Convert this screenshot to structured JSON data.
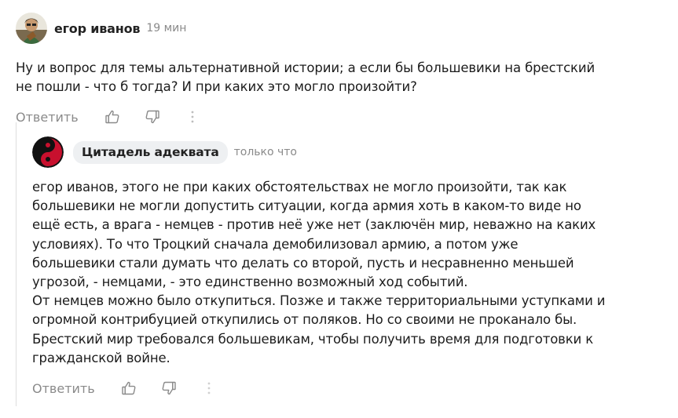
{
  "comments": [
    {
      "author": "егор иванов",
      "time": "19 мин",
      "text": "Ну и вопрос для темы альтернативной истории; а если бы большевики на брестский\nне пошли - что б тогда? И при каких это могло произойти?",
      "reply_label": "Ответить",
      "icons": [
        "thumbs-up-icon",
        "thumbs-down-icon",
        "more-vertical-icon"
      ]
    },
    {
      "author": "Цитадель адеквата",
      "time": "только что",
      "text": "егор иванов, этого не при каких обстоятельствах не могло произойти, так как\nбольшевики не могли допустить ситуации, когда армия хоть в каком-то виде но\nещё есть, а врага - немцев - против неё уже нет (заключён мир, неважно на каких\nусловиях). То что Троцкий сначала демобилизовал армию, а потом уже\nбольшевики стали думать что делать со второй, пусть и несравненно меньшей\nугрозой, - немцами, - это единственно возможный ход событий.\nОт немцев можно было откупиться. Позже и также территориальными уступками и\nогромной контрибуцией откупились от поляков. Но со своими не проканало бы.\nБрестский мир требовался большевикам, чтобы получить время для подготовки к\nгражданской войне.",
      "reply_label": "Ответить",
      "icons": [
        "thumbs-up-icon",
        "thumbs-down-icon",
        "more-vertical-icon"
      ]
    }
  ],
  "colors": {
    "text": "#1c1c1c",
    "muted": "#8a8a8a",
    "badge_bg": "#eef0f2",
    "thread_line": "#dedede",
    "yinyang_red": "#c8102e"
  }
}
